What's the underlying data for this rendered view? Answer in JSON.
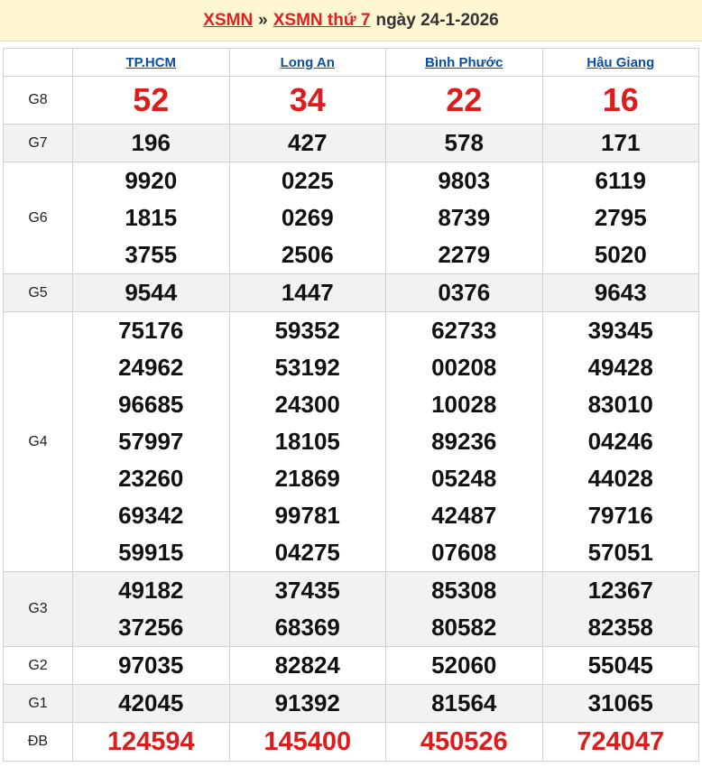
{
  "header": {
    "link1": "XSMN",
    "separator": "»",
    "link2": "XSMN thứ 7",
    "date": "ngày 24-1-2026"
  },
  "provinces": [
    "TP.HCM",
    "Long An",
    "Bình Phước",
    "Hậu Giang"
  ],
  "prizes": [
    {
      "label": "G8",
      "style": "big",
      "values": [
        [
          "52"
        ],
        [
          "34"
        ],
        [
          "22"
        ],
        [
          "16"
        ]
      ]
    },
    {
      "label": "G7",
      "style": "alt",
      "values": [
        [
          "196"
        ],
        [
          "427"
        ],
        [
          "578"
        ],
        [
          "171"
        ]
      ]
    },
    {
      "label": "G6",
      "style": "",
      "values": [
        [
          "9920",
          "1815",
          "3755"
        ],
        [
          "0225",
          "0269",
          "2506"
        ],
        [
          "9803",
          "8739",
          "2279"
        ],
        [
          "6119",
          "2795",
          "5020"
        ]
      ]
    },
    {
      "label": "G5",
      "style": "alt",
      "values": [
        [
          "9544"
        ],
        [
          "1447"
        ],
        [
          "0376"
        ],
        [
          "9643"
        ]
      ]
    },
    {
      "label": "G4",
      "style": "",
      "values": [
        [
          "75176",
          "24962",
          "96685",
          "57997",
          "23260",
          "69342",
          "59915"
        ],
        [
          "59352",
          "53192",
          "24300",
          "18105",
          "21869",
          "99781",
          "04275"
        ],
        [
          "62733",
          "00208",
          "10028",
          "89236",
          "05248",
          "42487",
          "07608"
        ],
        [
          "39345",
          "49428",
          "83010",
          "04246",
          "44028",
          "79716",
          "57051"
        ]
      ]
    },
    {
      "label": "G3",
      "style": "alt",
      "values": [
        [
          "49182",
          "37256"
        ],
        [
          "37435",
          "68369"
        ],
        [
          "85308",
          "80582"
        ],
        [
          "12367",
          "82358"
        ]
      ]
    },
    {
      "label": "G2",
      "style": "",
      "values": [
        [
          "97035"
        ],
        [
          "82824"
        ],
        [
          "52060"
        ],
        [
          "55045"
        ]
      ]
    },
    {
      "label": "G1",
      "style": "alt",
      "values": [
        [
          "42045"
        ],
        [
          "91392"
        ],
        [
          "81564"
        ],
        [
          "31065"
        ]
      ]
    },
    {
      "label": "ĐB",
      "style": "db",
      "values": [
        [
          "124594"
        ],
        [
          "145400"
        ],
        [
          "450526"
        ],
        [
          "724047"
        ]
      ]
    }
  ]
}
